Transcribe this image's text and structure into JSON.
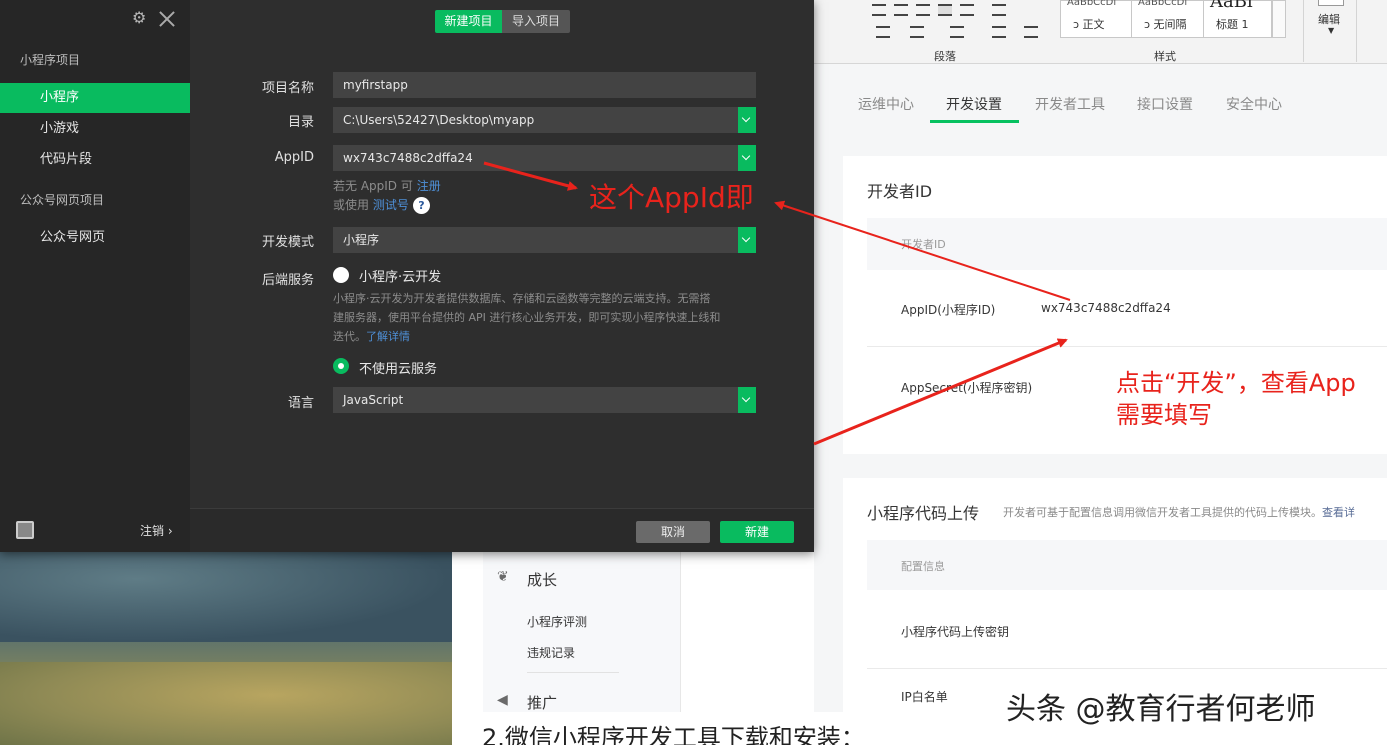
{
  "dialog": {
    "sidebar": {
      "section_mini": "小程序项目",
      "items": [
        {
          "label": "小程序"
        },
        {
          "label": "小游戏"
        },
        {
          "label": "代码片段"
        }
      ],
      "section_official": "公众号网页项目",
      "official_item": "公众号网页",
      "logout": "注销 ›"
    },
    "tabs": {
      "new": "新建项目",
      "import": "导入项目"
    },
    "form": {
      "name_label": "项目名称",
      "name_value": "myfirstapp",
      "dir_label": "目录",
      "dir_value": "C:\\Users\\52427\\Desktop\\myapp",
      "appid_label": "AppID",
      "appid_value": "wx743c7488c2dffa24",
      "appid_hint1_prefix": "若无 AppID 可",
      "appid_hint1_link": "注册",
      "appid_hint2_prefix": "或使用",
      "appid_hint2_link": "测试号",
      "help_glyph": "?",
      "mode_label": "开发模式",
      "mode_value": "小程序",
      "backend_label": "后端服务",
      "cloud_option": "小程序·云开发",
      "cloud_desc_1": "小程序·云开发为开发者提供数据库、存储和云函数等完整的云端支持。无需搭",
      "cloud_desc_2": "建服务器，使用平台提供的 API 进行核心业务开发，即可实现小程序快速上线和",
      "cloud_desc_3_prefix": "迭代。",
      "cloud_desc_link": "了解详情",
      "no_cloud_option": "不使用云服务",
      "lang_label": "语言",
      "lang_value": "JavaScript"
    },
    "buttons": {
      "cancel": "取消",
      "create": "新建"
    }
  },
  "ribbon": {
    "paragraph_label": "段落",
    "styles_label": "样式",
    "edit_label": "编辑",
    "styles": [
      {
        "preview": "AaBbCcDı",
        "name": "ↄ 正文"
      },
      {
        "preview": "AaBbCcDı",
        "name": "ↄ 无间隔"
      },
      {
        "preview": "AaBl",
        "name": "标题 1"
      }
    ]
  },
  "admin": {
    "tabs": [
      "运维中心",
      "开发设置",
      "开发者工具",
      "接口设置",
      "安全中心"
    ],
    "active_tab": "开发设置",
    "dev_id_card": {
      "title": "开发者ID",
      "head": "开发者ID",
      "appid_label": "AppID(小程序ID)",
      "appid_value": "wx743c7488c2dffa24",
      "secret_label": "AppSecret(小程序密钥)"
    },
    "upload_card": {
      "title": "小程序代码上传",
      "desc": "开发者可基于配置信息调用微信开发者工具提供的代码上传模块。",
      "desc_link": "查看详",
      "head": "配置信息",
      "row1": "小程序代码上传密钥",
      "row2": "IP白名单"
    },
    "nav": {
      "group_growth": "成长",
      "growth_items": [
        "小程序评测",
        "违规记录"
      ],
      "group_promo": "推广"
    }
  },
  "article_text": "2.微信小程序开发工具下载和安装：",
  "annotations": {
    "note_appid": "这个AppId即",
    "note_dev_line1": "点击“开发”，查看App",
    "note_dev_line2": "需要填写",
    "color": "#e8231c"
  },
  "watermark": "头条 @教育行者何老师"
}
